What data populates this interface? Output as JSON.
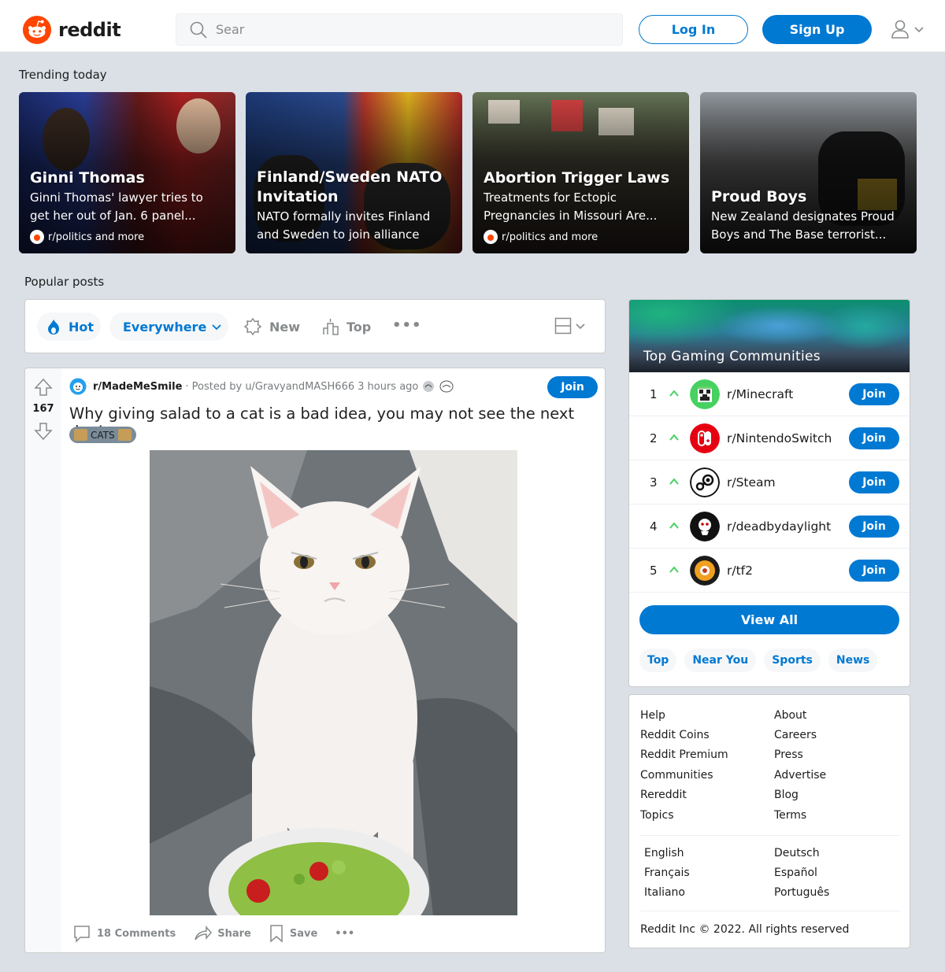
{
  "header": {
    "logo_text": "reddit",
    "search_value": "Sear",
    "login_label": "Log In",
    "signup_label": "Sign Up"
  },
  "trending": {
    "heading": "Trending today",
    "cards": [
      {
        "title": "Ginni Thomas",
        "subtitle": "Ginni Thomas' lawyer tries to get her out of Jan. 6 panel...",
        "meta": "r/politics and more"
      },
      {
        "title": "Finland/Sweden NATO Invitation",
        "subtitle": "NATO formally invites Finland and Sweden to join alliance",
        "meta": ""
      },
      {
        "title": "Abortion Trigger Laws",
        "subtitle": "Treatments for Ectopic Pregnancies in Missouri Are...",
        "meta": "r/politics and more"
      },
      {
        "title": "Proud Boys",
        "subtitle": "New Zealand designates Proud Boys and The Base terrorist...",
        "meta": ""
      }
    ]
  },
  "popular": {
    "heading": "Popular posts",
    "sort": {
      "hot": "Hot",
      "everywhere": "Everywhere",
      "new": "New",
      "top": "Top",
      "more": "•••"
    }
  },
  "post": {
    "subreddit": "r/MadeMeSmile",
    "posted_by": "· Posted by u/GravyandMASH666",
    "time": "3 hours ago",
    "join_label": "Join",
    "score": "167",
    "title": "Why giving salad to a cat is a bad idea, you may not see the next day!",
    "flair": "CATS",
    "comments": "18 Comments",
    "share": "Share",
    "save": "Save",
    "more": "•••"
  },
  "gaming": {
    "title": "Top  Gaming  Communities",
    "join_label": "Join",
    "communities": [
      {
        "rank": "1",
        "name": "r/Minecraft"
      },
      {
        "rank": "2",
        "name": "r/NintendoSwitch"
      },
      {
        "rank": "3",
        "name": "r/Steam"
      },
      {
        "rank": "4",
        "name": "r/deadbydaylight"
      },
      {
        "rank": "5",
        "name": "r/tf2"
      }
    ],
    "view_all": "View All",
    "pills": [
      "Top",
      "Near You",
      "Sports",
      "News"
    ]
  },
  "footer": {
    "col1": [
      "Help",
      "Reddit Coins",
      "Reddit Premium",
      "Communities",
      "Rereddit",
      "Topics"
    ],
    "col2": [
      "About",
      "Careers",
      "Press",
      "Advertise",
      "Blog",
      "Terms"
    ],
    "lang1": [
      "English",
      "Français",
      "Italiano"
    ],
    "lang2": [
      "Deutsch",
      "Español",
      "Português"
    ],
    "copyright": "Reddit Inc © 2022. All rights reserved"
  },
  "colors": {
    "brand": "#ff4500",
    "accent": "#0079d3",
    "upvote": "#ff4500",
    "trend_green": "#46d160"
  }
}
